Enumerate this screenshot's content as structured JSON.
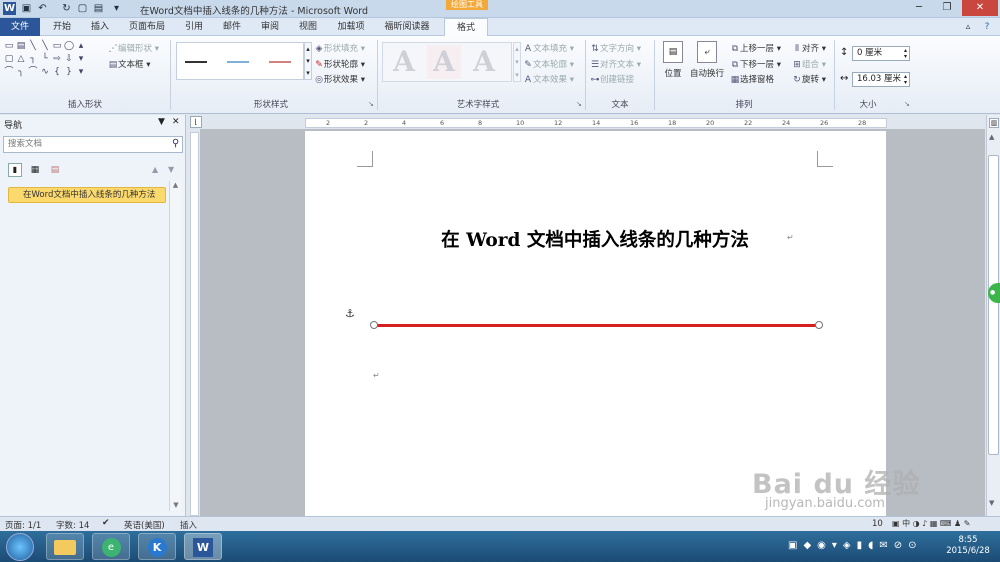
{
  "window": {
    "title": "在Word文档中插入线条的几种方法  -  Microsoft Word",
    "context_tab": "绘图工具"
  },
  "tabs": [
    "文件",
    "开始",
    "插入",
    "页面布局",
    "引用",
    "邮件",
    "审阅",
    "视图",
    "加载项",
    "福昕阅读器",
    "格式"
  ],
  "ribbon": {
    "insert_shapes": {
      "label": "插入形状",
      "edit_shape": "编辑形状",
      "text_box": "文本框"
    },
    "shape_styles": {
      "label": "形状样式",
      "fill": "形状填充",
      "outline": "形状轮廓",
      "effects": "形状效果"
    },
    "wordart": {
      "label": "艺术字样式",
      "text_fill": "文本填充",
      "text_outline": "文本轮廓",
      "text_effects": "文本效果"
    },
    "text": {
      "label": "文本",
      "direction": "文字方向",
      "align": "对齐文本",
      "link": "创建链接"
    },
    "arrange": {
      "label": "排列",
      "position": "位置",
      "wrap": "自动换行",
      "forward": "上移一层",
      "backward": "下移一层",
      "pane": "选择窗格",
      "align": "对齐",
      "group": "组合",
      "rotate": "旋转"
    },
    "size": {
      "label": "大小",
      "height": "0 厘米",
      "width": "16.03 厘米"
    }
  },
  "nav": {
    "title": "导航",
    "search_placeholder": "搜索文档",
    "item": "在Word文档中插入线条的几种方法"
  },
  "document": {
    "title": "在 Word 文档中插入线条的几种方法",
    "line_color": "#d42020"
  },
  "ruler": {
    "h_labels": [
      "2",
      "2",
      "4",
      "6",
      "8",
      "10",
      "12",
      "14",
      "16",
      "18",
      "20",
      "22",
      "24",
      "26",
      "28"
    ]
  },
  "status": {
    "page": "页面: 1/1",
    "words": "字数: 14",
    "lang": "英语(美国)",
    "mode": "插入",
    "zoom": "10"
  },
  "clock": {
    "time": "8:55",
    "date": "2015/6/28"
  },
  "watermark": {
    "brand": "Bai du 经验",
    "url": "jingyan.baidu.com"
  }
}
